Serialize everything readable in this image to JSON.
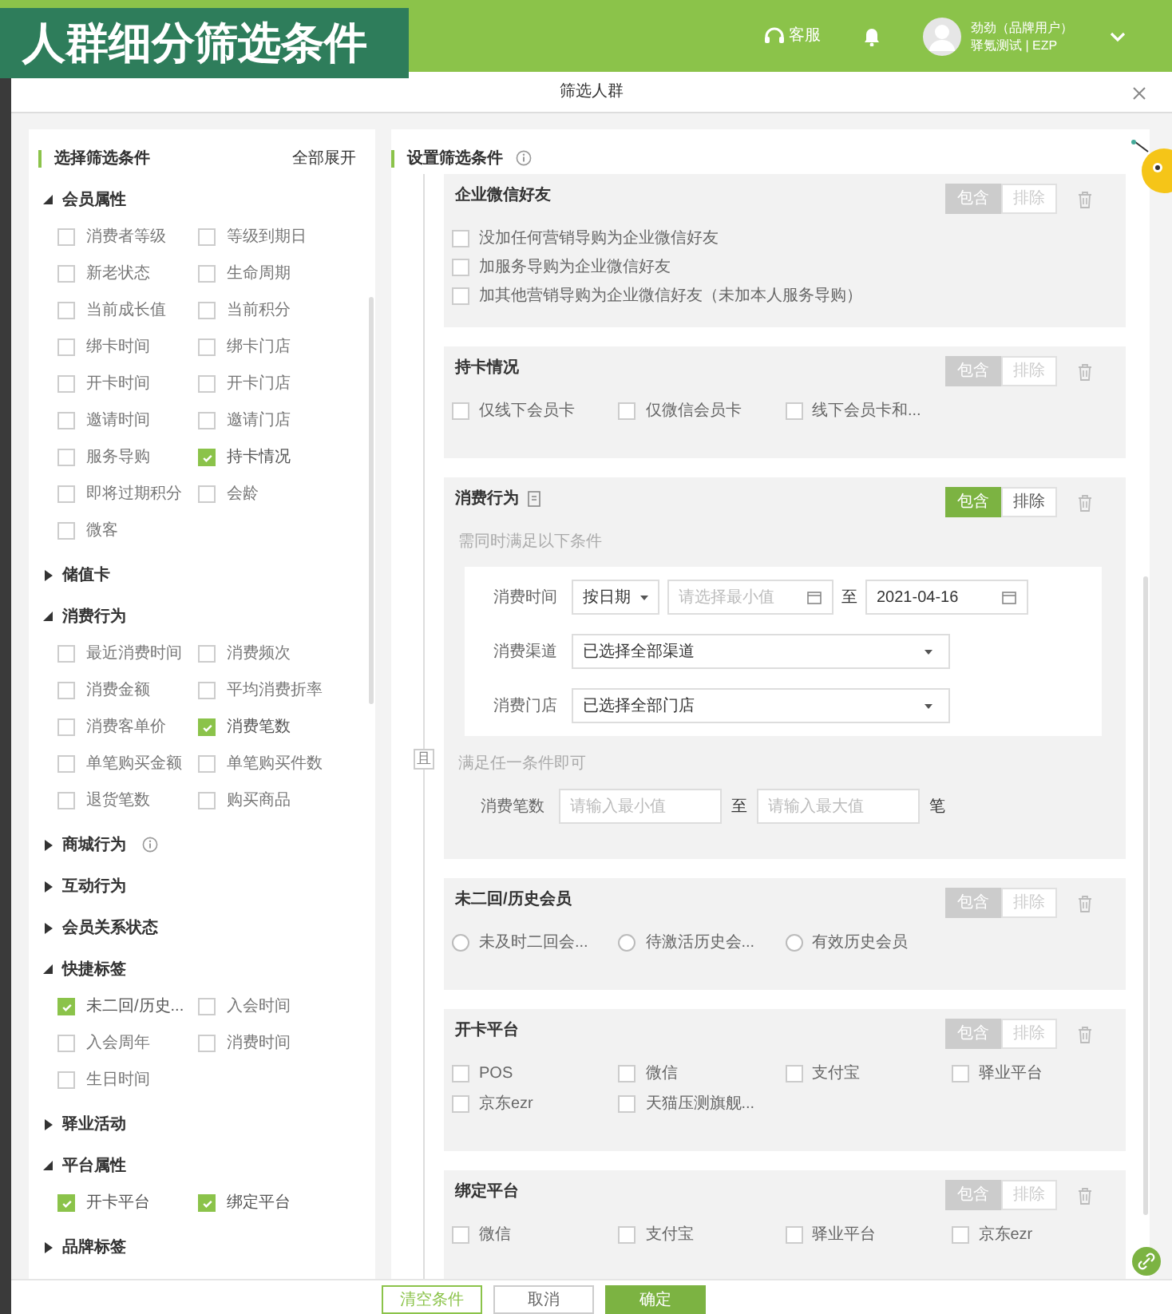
{
  "app_title": "人群细分筛选条件",
  "header": {
    "service": "客服",
    "user_name": "劲劲（品牌用户）",
    "user_org": "驿氪测试 | EZP"
  },
  "modal": {
    "title": "筛选人群"
  },
  "left_panel": {
    "title": "选择筛选条件",
    "expand_all": "全部展开",
    "groups": [
      {
        "label": "会员属性",
        "expanded": true,
        "items": [
          {
            "label": "消费者等级",
            "checked": false
          },
          {
            "label": "等级到期日",
            "checked": false
          },
          {
            "label": "新老状态",
            "checked": false
          },
          {
            "label": "生命周期",
            "checked": false
          },
          {
            "label": "当前成长值",
            "checked": false
          },
          {
            "label": "当前积分",
            "checked": false
          },
          {
            "label": "绑卡时间",
            "checked": false
          },
          {
            "label": "绑卡门店",
            "checked": false
          },
          {
            "label": "开卡时间",
            "checked": false
          },
          {
            "label": "开卡门店",
            "checked": false
          },
          {
            "label": "邀请时间",
            "checked": false
          },
          {
            "label": "邀请门店",
            "checked": false
          },
          {
            "label": "服务导购",
            "checked": false
          },
          {
            "label": "持卡情况",
            "checked": true
          },
          {
            "label": "即将过期积分",
            "checked": false
          },
          {
            "label": "会龄",
            "checked": false
          },
          {
            "label": "微客",
            "checked": false
          }
        ]
      },
      {
        "label": "储值卡",
        "expanded": false
      },
      {
        "label": "消费行为",
        "expanded": true,
        "items": [
          {
            "label": "最近消费时间",
            "checked": false
          },
          {
            "label": "消费频次",
            "checked": false
          },
          {
            "label": "消费金额",
            "checked": false
          },
          {
            "label": "平均消费折率",
            "checked": false
          },
          {
            "label": "消费客单价",
            "checked": false
          },
          {
            "label": "消费笔数",
            "checked": true
          },
          {
            "label": "单笔购买金额",
            "checked": false
          },
          {
            "label": "单笔购买件数",
            "checked": false
          },
          {
            "label": "退货笔数",
            "checked": false
          },
          {
            "label": "购买商品",
            "checked": false
          }
        ]
      },
      {
        "label": "商城行为",
        "expanded": false,
        "info": true
      },
      {
        "label": "互动行为",
        "expanded": false
      },
      {
        "label": "会员关系状态",
        "expanded": false
      },
      {
        "label": "快捷标签",
        "expanded": true,
        "items": [
          {
            "label": "未二回/历史...",
            "checked": true
          },
          {
            "label": "入会时间",
            "checked": false
          },
          {
            "label": "入会周年",
            "checked": false
          },
          {
            "label": "消费时间",
            "checked": false
          },
          {
            "label": "生日时间",
            "checked": false
          }
        ]
      },
      {
        "label": "驿业活动",
        "expanded": false
      },
      {
        "label": "平台属性",
        "expanded": true,
        "items": [
          {
            "label": "开卡平台",
            "checked": true
          },
          {
            "label": "绑定平台",
            "checked": true
          }
        ]
      },
      {
        "label": "品牌标签",
        "expanded": false
      }
    ]
  },
  "right_panel": {
    "title": "设置筛选条件",
    "relation": "且",
    "cards": [
      {
        "kind": "checkbox_list",
        "title": "企业微信好友",
        "active": false,
        "include": "包含",
        "exclude": "排除",
        "options": [
          {
            "label": "没加任何营销导购为企业微信好友",
            "checked": false
          },
          {
            "label": "加服务导购为企业微信好友",
            "checked": false
          },
          {
            "label": "加其他营销导购为企业微信好友（未加本人服务导购）",
            "checked": false
          }
        ]
      },
      {
        "kind": "checkbox_grid",
        "title": "持卡情况",
        "active": false,
        "include": "包含",
        "exclude": "排除",
        "options": [
          {
            "label": "仅线下会员卡",
            "checked": false
          },
          {
            "label": "仅微信会员卡",
            "checked": false
          },
          {
            "label": "线下会员卡和...",
            "checked": false
          }
        ]
      },
      {
        "kind": "consumption",
        "title": "消费行为",
        "active": true,
        "include": "包含",
        "exclude": "排除",
        "note_all": "需同时满足以下条件",
        "rows": [
          {
            "kind": "date_range",
            "label": "消费时间",
            "mode": "按日期",
            "min_placeholder": "请选择最小值",
            "separator": "至",
            "max_value": "2021-04-16"
          },
          {
            "kind": "select",
            "label": "消费渠道",
            "value": "已选择全部渠道"
          },
          {
            "kind": "select",
            "label": "消费门店",
            "value": "已选择全部门店"
          }
        ],
        "note_any": "满足任一条件即可",
        "any_rows": [
          {
            "kind": "number_range",
            "label": "消费笔数",
            "min_placeholder": "请输入最小值",
            "separator": "至",
            "max_placeholder": "请输入最大值",
            "unit": "笔"
          }
        ]
      },
      {
        "kind": "radio_grid",
        "title": "未二回/历史会员",
        "active": false,
        "include": "包含",
        "exclude": "排除",
        "options": [
          {
            "label": "未及时二回会...",
            "selected": false
          },
          {
            "label": "待激活历史会...",
            "selected": false
          },
          {
            "label": "有效历史会员",
            "selected": false
          }
        ]
      },
      {
        "kind": "checkbox_grid",
        "title": "开卡平台",
        "active": false,
        "include": "包含",
        "exclude": "排除",
        "options": [
          {
            "label": "POS",
            "checked": false
          },
          {
            "label": "微信",
            "checked": false
          },
          {
            "label": "支付宝",
            "checked": false
          },
          {
            "label": "驿业平台",
            "checked": false
          },
          {
            "label": "京东ezr",
            "checked": false
          },
          {
            "label": "天猫压测旗舰...",
            "checked": false
          }
        ]
      },
      {
        "kind": "checkbox_grid",
        "title": "绑定平台",
        "active": false,
        "include": "包含",
        "exclude": "排除",
        "options": [
          {
            "label": "微信",
            "checked": false
          },
          {
            "label": "支付宝",
            "checked": false
          },
          {
            "label": "驿业平台",
            "checked": false
          },
          {
            "label": "京东ezr",
            "checked": false
          }
        ]
      }
    ]
  },
  "footer": {
    "buttons": [
      {
        "label": "清空条件",
        "kind": "outline"
      },
      {
        "label": "取消",
        "kind": "plain"
      },
      {
        "label": "确定",
        "kind": "primary"
      }
    ]
  }
}
